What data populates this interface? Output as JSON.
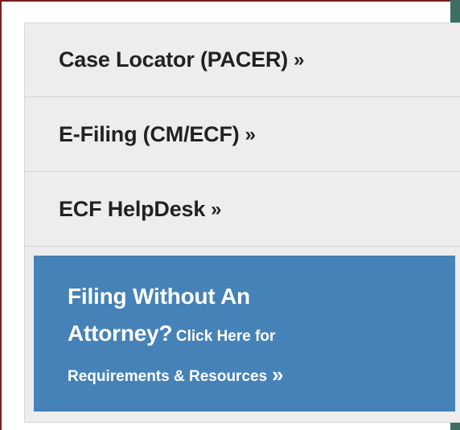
{
  "menu": {
    "items": [
      {
        "label": "Case Locator (PACER)",
        "chevron": "»"
      },
      {
        "label": "E-Filing (CM/ECF)",
        "chevron": "»"
      },
      {
        "label": "ECF HelpDesk",
        "chevron": "»"
      }
    ]
  },
  "callout": {
    "line1": "Filing Without An",
    "line2_big": "Attorney?",
    "line2_small": "Click Here for",
    "line3": "Requirements & Resources",
    "chevron": "»",
    "background_color": "#4582b8"
  },
  "colors": {
    "page_background": "#3e6e61",
    "frame_border": "#7a1f1f",
    "panel_background": "#ededed"
  }
}
